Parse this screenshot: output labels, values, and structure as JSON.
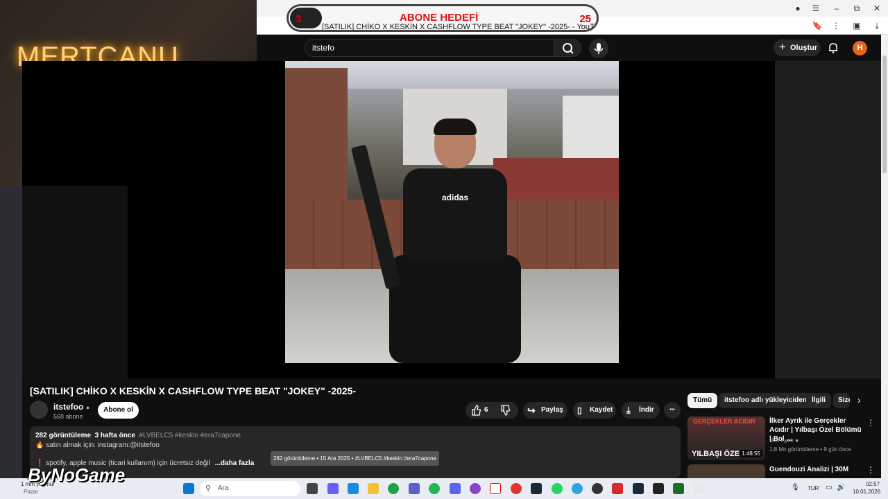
{
  "webcam": {
    "overlay_name": "MERTCANU"
  },
  "tab": {
    "title": "[SATILIK] CHİKO X KESKİN X CASHFLOW TYPE BEAT \"JOKEY\" -2025- - YouTube",
    "goal_label": "ABONE HEDEFİ",
    "goal_current": "3",
    "goal_target": "25"
  },
  "window_controls": {
    "minimize": "–",
    "maximize": "⧉",
    "close": "✕",
    "menu": "☰"
  },
  "header": {
    "search_value": "itstefo",
    "create_label": "Oluştur",
    "avatar_letter": "H"
  },
  "video": {
    "title": "[SATILIK] CHİKO X KESKİN X CASHFLOW TYPE BEAT \"JOKEY\" -2025-",
    "thumbnail_shirt_text": "adidas"
  },
  "channel": {
    "name": "itstefoo",
    "subscribers": "568 abone",
    "subscribe_label": "Abone ol"
  },
  "actions": {
    "likes": "6",
    "share_label": "Paylaş",
    "save_label": "Kaydet",
    "download_label": "İndir",
    "more": "•••"
  },
  "description": {
    "views": "282 görüntüleme",
    "age": "3 hafta önce",
    "tags": "#LVBELC5 #keskin #era7capone",
    "line2": "🔥 satın almak için: instagram:@itstefoo",
    "line3": "❗ spotify, apple music (ticari kullanım) için ücretsiz değil",
    "more_label": "...daha fazla"
  },
  "tooltip": "282 görüntüleme • 15 Ara 2025 • #LVBELC5 #keskin #era7capone",
  "chips": [
    "Tümü",
    "itstefoo adlı yükleyiciden",
    "İlgili",
    "Size"
  ],
  "recommendations": [
    {
      "title": "İlker Ayrık ile Gerçekler Acıdır | Yılbaşı Özel Bölümü | Bol ...",
      "channel": "İlker Ayrık",
      "meta": "1,8 Mn görüntüleme • 9 gün önce",
      "duration": "1:48:55",
      "thumb_top": "GERÇEKLER ACIDIR",
      "thumb_bottom": "YILBAŞI ÖZE"
    },
    {
      "title": "Guendouzi Analizi | 30M",
      "channel": "",
      "meta": "",
      "duration": "",
      "thumb_top": "",
      "thumb_bottom": ""
    }
  ],
  "overlay": {
    "brand": "ByNoGame"
  },
  "taskbar": {
    "search_placeholder": "Ara",
    "weather": "1 mm yağmur",
    "weather_day": "Pazar",
    "lang": "TUR",
    "time": "02:57",
    "date": "10.01.2026"
  }
}
